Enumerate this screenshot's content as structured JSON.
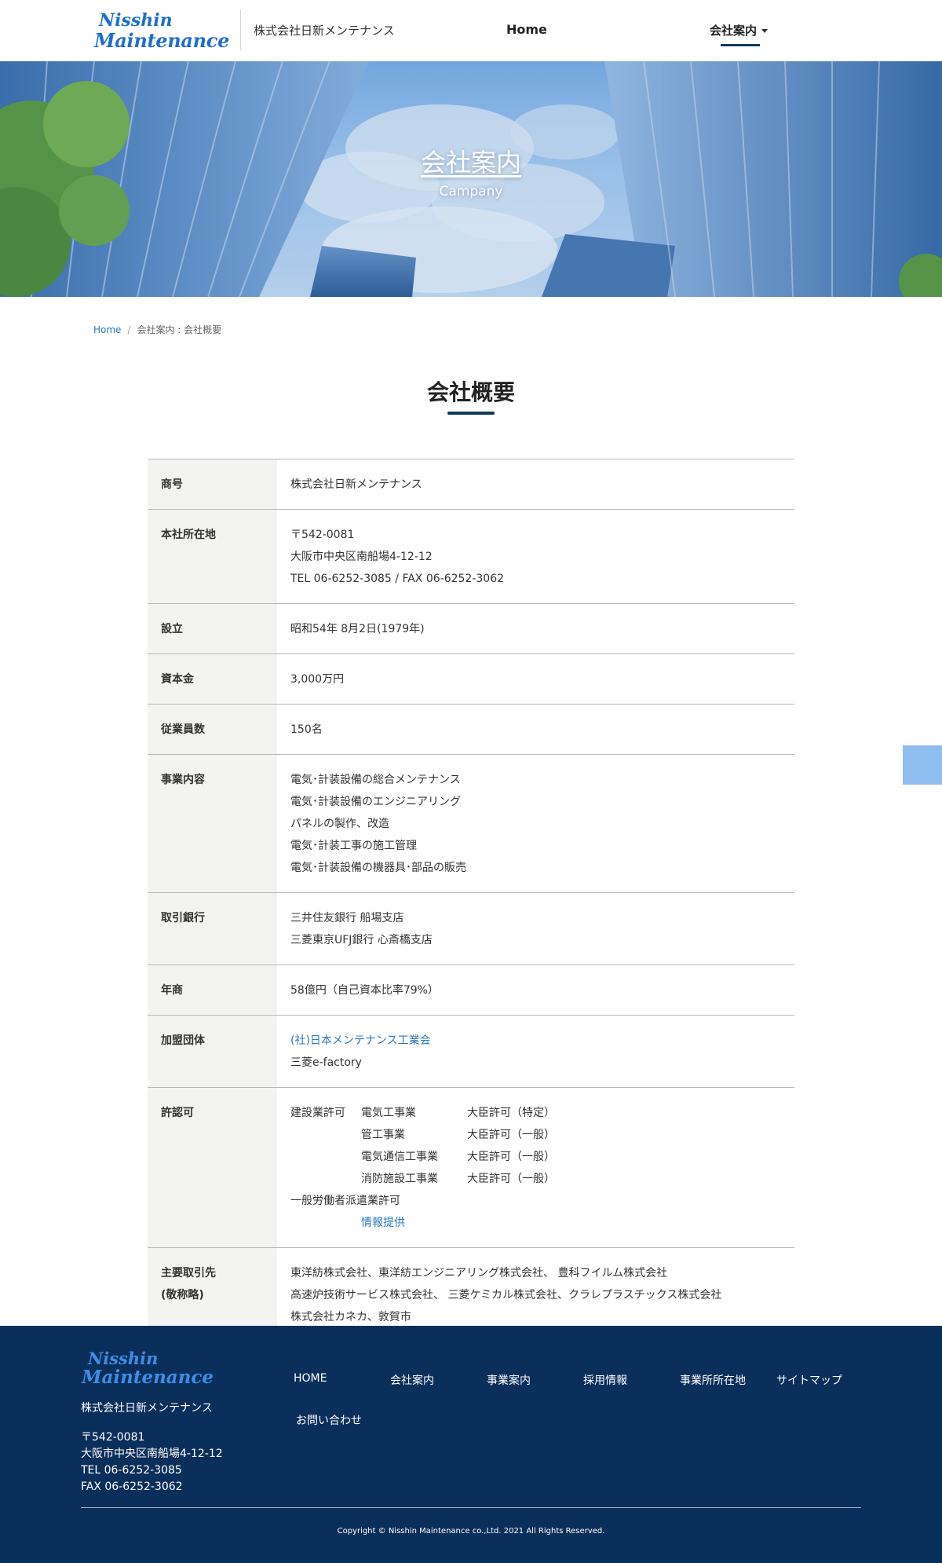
{
  "header": {
    "logo_line1": "Nisshin",
    "logo_line2": "Maintenance",
    "company_name": "株式会社日新メンテナンス",
    "nav_home": "Home",
    "nav_company": "会社案内"
  },
  "hero": {
    "title": "会社案内",
    "subtitle": "Campany"
  },
  "breadcrumb": {
    "home": "Home",
    "separator": "/",
    "current": "会社案内 : 会社概要"
  },
  "section": {
    "title": "会社概要"
  },
  "company_info": {
    "trade_name": {
      "label": "商号",
      "value": "株式会社日新メンテナンス"
    },
    "head_office": {
      "label": "本社所在地",
      "postal": "〒542-0081",
      "address": "大阪市中央区南船場4-12-12",
      "tel_fax": "TEL 06-6252-3085 / FAX 06-6252-3062"
    },
    "established": {
      "label": "設立",
      "value": "昭和54年 8月2日(1979年)"
    },
    "capital": {
      "label": "資本金",
      "value": "3,000万円"
    },
    "employees": {
      "label": "従業員数",
      "value": "150名"
    },
    "business": {
      "label": "事業内容",
      "items": [
        "電気･計装設備の総合メンテナンス",
        "電気･計装設備のエンジニアリング",
        "パネルの製作、改造",
        "電気･計装工事の施工管理",
        "電気･計装設備の機器具･部品の販売"
      ]
    },
    "banks": {
      "label": "取引銀行",
      "items": [
        "三井住友銀行 船場支店",
        "三菱東京UFJ銀行 心斎橋支店"
      ]
    },
    "annual_sales": {
      "label": "年商",
      "value": "58億円（自己資本比率79%）"
    },
    "associations": {
      "label": "加盟団体",
      "link": "(社)日本メンテナンス工業会",
      "other": "三菱e-factory"
    },
    "licenses": {
      "label": "許認可",
      "construction_label": "建設業許可",
      "rows": [
        {
          "work": "電気工事業",
          "type": "大臣許可（特定）"
        },
        {
          "work": "管工事業",
          "type": "大臣許可（一般）"
        },
        {
          "work": "電気通信工事業",
          "type": "大臣許可（一般）"
        },
        {
          "work": "消防施設工事業",
          "type": "大臣許可（一般）"
        }
      ],
      "dispatch": "一般労働者派遣業許可",
      "info_link": "情報提供"
    },
    "clients": {
      "label_line1": "主要取引先",
      "label_line2": "(敬称略)",
      "items": [
        "東洋紡株式会社、東洋紡エンジニアリング株式会社、 豊科フイルム株式会社",
        "高速炉技術サービス株式会社、 三菱ケミカル株式会社、クラレプラスチックス株式会社",
        "株式会社カネカ、敦賀市"
      ]
    }
  },
  "footer": {
    "logo_line1": "Nisshin",
    "logo_line2": "Maintenance",
    "company_name": "株式会社日新メンテナンス",
    "postal": "〒542-0081",
    "address": "大阪市中央区南船場4-12-12",
    "tel": "TEL 06-6252-3085",
    "fax": "FAX 06-6252-3062",
    "nav": [
      "HOME",
      "会社案内",
      "事業案内",
      "採用情報",
      "事業所所在地",
      "サイトマップ",
      "お問い合わせ"
    ],
    "copyright": "Copyright © Nisshin Maintenance co.,Ltd. 2021 All Rights Reserved."
  },
  "colors": {
    "accent_navy": "#0e3a5e",
    "link_blue": "#2a7ab8",
    "footer_bg": "#0b2f5b",
    "logo_blue": "#1f6fc9",
    "table_label_bg": "#f3f3f1"
  }
}
